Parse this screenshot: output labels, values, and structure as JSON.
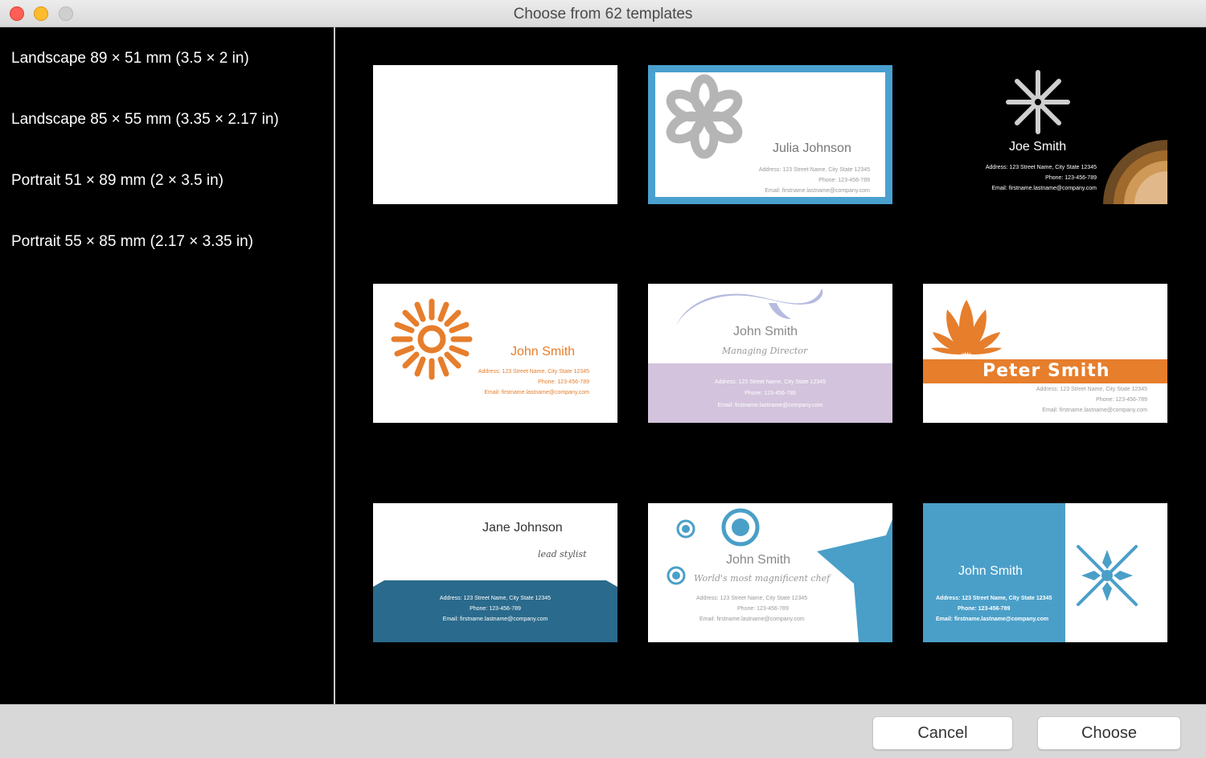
{
  "window": {
    "title": "Choose from 62 templates"
  },
  "sidebar": {
    "items": [
      {
        "label": "Landscape 89 × 51 mm (3.5 × 2 in)"
      },
      {
        "label": "Landscape 85 × 55 mm (3.35 × 2.17 in)"
      },
      {
        "label": "Portrait 51 × 89 mm (2 × 3.5 in)"
      },
      {
        "label": "Portrait 55 × 85 mm (2.17 × 3.35 in)"
      }
    ]
  },
  "cards": {
    "julia": {
      "name": "Julia Johnson",
      "address": "Address: 123 Street Name, City State 12345",
      "phone": "Phone: 123-456-789",
      "email": "Email: firstname.lastname@company.com"
    },
    "joe": {
      "name": "Joe Smith",
      "address": "Address: 123 Street Name, City State 12345",
      "phone": "Phone: 123-456-789",
      "email": "Email: firstname.lastname@company.com"
    },
    "john_sun": {
      "name": "John Smith",
      "address": "Address: 123 Street Name, City State 12345",
      "phone": "Phone: 123-456-789",
      "email": "Email: firstname.lastname@company.com"
    },
    "john_md": {
      "name": "John Smith",
      "title": "Managing Director",
      "address": "Address: 123 Street Name, City State 12345",
      "phone": "Phone: 123-456-789",
      "email": "Email: firstname.lastname@company.com"
    },
    "peter": {
      "name": "Peter Smith",
      "address": "Address: 123 Street Name, City State 12345",
      "phone": "Phone: 123-456-789",
      "email": "Email: firstname.lastname@company.com"
    },
    "jane": {
      "name": "Jane Johnson",
      "title": "lead stylist",
      "address": "Address: 123 Street Name, City State 12345",
      "phone": "Phone: 123-456-789",
      "email": "Email: firstname.lastname@company.com"
    },
    "john_chef": {
      "name": "John Smith",
      "title": "World's most magnificent chef",
      "address": "Address: 123 Street Name, City State 12345",
      "phone": "Phone: 123-456-789",
      "email": "Email: firstname.lastname@company.com"
    },
    "john_blue": {
      "name": "John Smith",
      "address": "Address: 123 Street Name, City State 12345",
      "phone": "Phone: 123-456-789",
      "email": "Email: firstname.lastname@company.com"
    }
  },
  "buttons": {
    "cancel": "Cancel",
    "choose": "Choose"
  },
  "colors": {
    "selected_border": "#4aa0cf",
    "orange": "#e67e2c",
    "lavender": "#d3c3dc",
    "teal_dark": "#2a6a8c",
    "blue": "#4a9fc8"
  }
}
